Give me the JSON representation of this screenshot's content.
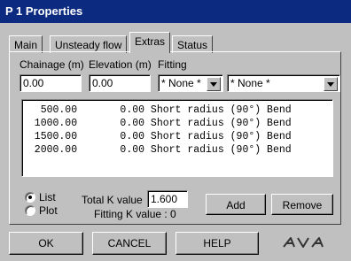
{
  "window": {
    "title": "P 1 Properties"
  },
  "tabs": [
    {
      "label": "Main"
    },
    {
      "label": "Unsteady flow"
    },
    {
      "label": "Extras",
      "active": true
    },
    {
      "label": "Status"
    }
  ],
  "fields": {
    "chainage": {
      "label": "Chainage (m)",
      "value": "0.00"
    },
    "elevation": {
      "label": "Elevation (m)",
      "value": "0.00"
    },
    "fitting": {
      "label": "Fitting",
      "combo1": "* None *",
      "combo2": "* None *"
    }
  },
  "list": {
    "rows": [
      "   500.00       0.00 Short radius (90°) Bend",
      "  1000.00       0.00 Short radius (90°) Bend",
      "  1500.00       0.00 Short radius (90°) Bend",
      "  2000.00       0.00 Short radius (90°) Bend"
    ]
  },
  "view": {
    "list_label": "List",
    "plot_label": "Plot",
    "selected": "List"
  },
  "k": {
    "total_label": "Total K value",
    "total_value": "1.600",
    "fitting_text": "Fitting K value : 0"
  },
  "actions": {
    "add": "Add",
    "remove": "Remove"
  },
  "footer": {
    "ok": "OK",
    "cancel": "CANCEL",
    "help": "HELP",
    "logo_text": "AVA"
  },
  "colors": {
    "titlebar": "#0c2a80",
    "face": "#c0c0c0"
  }
}
